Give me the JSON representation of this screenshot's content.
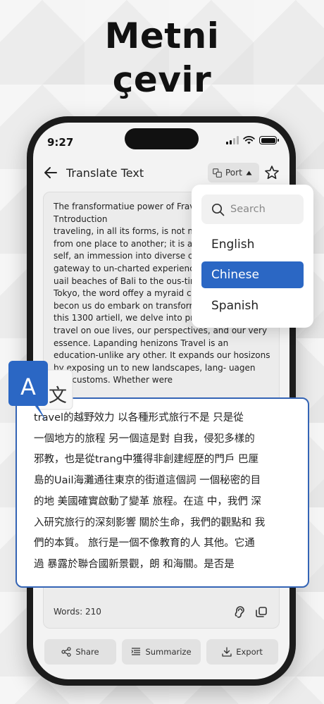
{
  "headline": {
    "line1": "Metni",
    "line2": "çevir"
  },
  "status": {
    "time": "9:27"
  },
  "header": {
    "title": "Translate Text",
    "lang_chip": "Port"
  },
  "source": {
    "text": "The fransformatiue power of Frav\nTntroduction\ntraveling, in all its forms, is not  m\nfrom one place to another; it is ar\nself, an immession into diverse cu\ngateway to un-charted experienc\nuail beaches of Bali to the ous-tir\nTokyo, the word offey  a myraid c\nbecon us do embark on transform\nthis 1300 artiell, we delve into pro\ntravel on oue lives, our perspectives, and our very\nessence. Lapanding henizons Travel is an\neducation-unlike ary other. It expands our hosizons\nby exposing un to new landscapes, lang- uagen\nand customs. Whether were",
    "word_count": "Words: 210"
  },
  "actions": {
    "share": "Share",
    "summarize": "Summarize",
    "export": "Export"
  },
  "dropdown": {
    "search_placeholder": "Search",
    "options": [
      {
        "label": "English"
      },
      {
        "label": "Chinese",
        "selected": true
      },
      {
        "label": "Spanish"
      }
    ]
  },
  "translation": {
    "text": "travel的越野效力 以各種形式旅行不是  只是從\n一個地方的旅程 另一個這是對 自我，侵犯多樣的\n邪教，也是從trang中獲得非創建經歷的門戶 巴厘\n島的Uail海灘通往東京的街道這個詞  一個秘密的目\n的地 美國確實啟動了變革 旅程。在這 中，我們 深\n入研究旅行的深刻影響 關於生命，我們的觀點和 我\n們的本質。 旅行是一個不像教育的人 其他。它通\n過 暴露於聯合國新景觀，朗 和海關。是否是"
  },
  "badge": {
    "letter_a": "A",
    "letter_x": "文"
  },
  "colors": {
    "accent": "#2b67c4",
    "border": "#3464b5"
  }
}
